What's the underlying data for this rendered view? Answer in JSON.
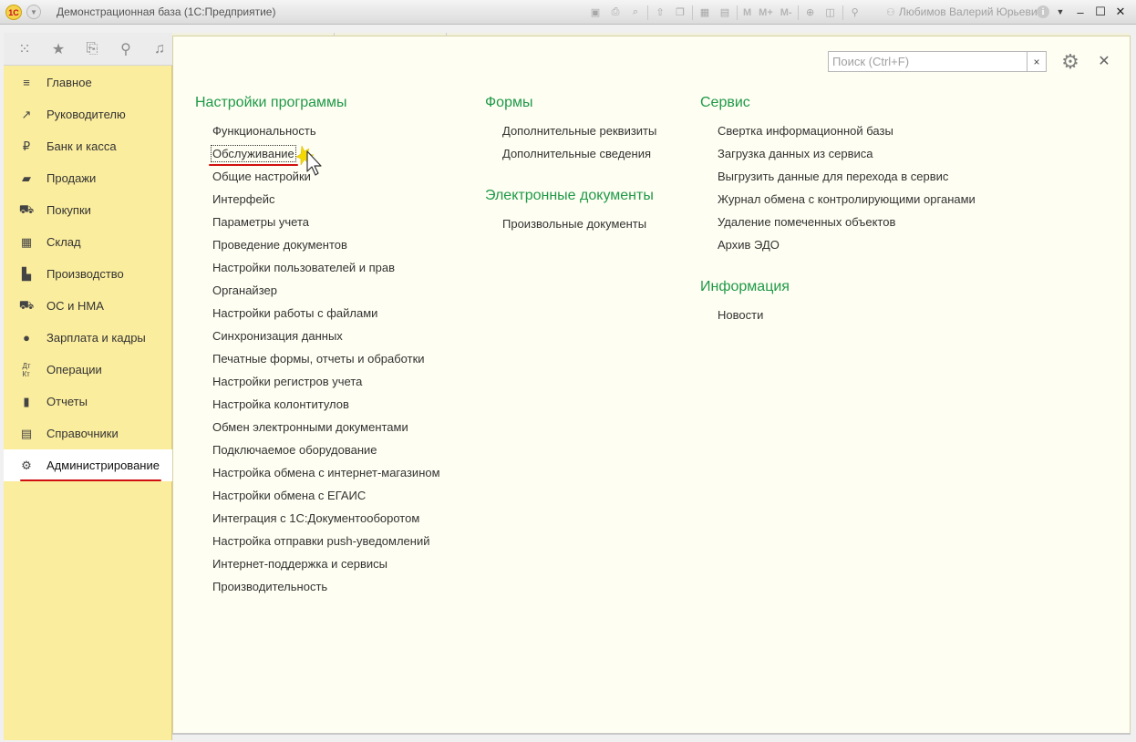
{
  "titlebar": {
    "logo": "1С",
    "title": "Демонстрационная база  (1С:Предприятие)",
    "toolbar_letters": [
      "M",
      "M+",
      "M-"
    ],
    "user": "Любимов Валерий Юрьевич"
  },
  "sidebar": {
    "items": [
      {
        "label": "Главное",
        "icon": "menu-lines-icon"
      },
      {
        "label": "Руководителю",
        "icon": "trend-icon"
      },
      {
        "label": "Банк и касса",
        "icon": "ruble-coin-icon"
      },
      {
        "label": "Продажи",
        "icon": "shopping-bag-icon"
      },
      {
        "label": "Покупки",
        "icon": "shopping-cart-icon"
      },
      {
        "label": "Склад",
        "icon": "warehouse-icon"
      },
      {
        "label": "Производство",
        "icon": "factory-icon"
      },
      {
        "label": "ОС и НМА",
        "icon": "truck-icon"
      },
      {
        "label": "Зарплата и кадры",
        "icon": "person-icon"
      },
      {
        "label": "Операции",
        "icon": "dt-kt-icon"
      },
      {
        "label": "Отчеты",
        "icon": "bar-chart-icon"
      },
      {
        "label": "Справочники",
        "icon": "books-icon"
      },
      {
        "label": "Администрирование",
        "icon": "gear-icon",
        "active": true
      }
    ]
  },
  "search": {
    "placeholder": "Поиск (Ctrl+F)",
    "clear": "×"
  },
  "sections": {
    "settings": {
      "title": "Настройки программы",
      "links": [
        "Функциональность",
        "Обслуживание",
        "Общие настройки",
        "Интерфейс",
        "Параметры учета",
        "Проведение документов",
        "Настройки пользователей и прав",
        "Органайзер",
        "Настройки работы с файлами",
        "Синхронизация данных",
        "Печатные формы, отчеты и обработки",
        "Настройки регистров учета",
        "Настройка колонтитулов",
        "Обмен электронными документами",
        "Подключаемое оборудование",
        "Настройка обмена с интернет-магазином",
        "Настройки обмена с ЕГАИС",
        "Интеграция с 1С:Документооборотом",
        "Настройка отправки push-уведомлений",
        "Интернет-поддержка и сервисы",
        "Производительность"
      ]
    },
    "forms": {
      "title": "Формы",
      "links": [
        "Дополнительные реквизиты",
        "Дополнительные сведения"
      ]
    },
    "edocs": {
      "title": "Электронные документы",
      "links": [
        "Произвольные документы"
      ]
    },
    "service": {
      "title": "Сервис",
      "links": [
        "Свертка информационной базы",
        "Загрузка данных из сервиса",
        "Выгрузить данные для перехода в сервис",
        "Журнал обмена с контролирующими органами",
        "Удаление помеченных объектов",
        "Архив ЭДО"
      ]
    },
    "info": {
      "title": "Информация",
      "links": [
        "Новости"
      ]
    }
  },
  "colors": {
    "section_title": "#1e9a48",
    "sidebar_bg": "#fbed9e",
    "main_bg": "#fffef2",
    "highlight_red": "#d20f0f"
  }
}
